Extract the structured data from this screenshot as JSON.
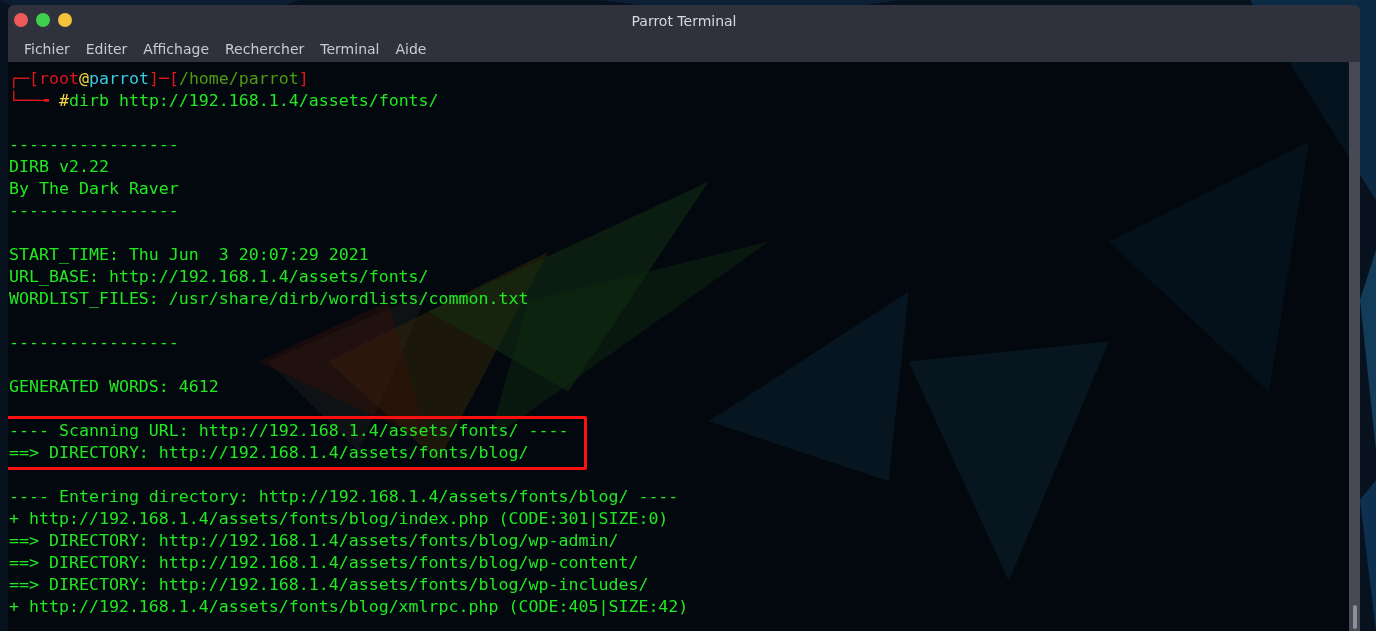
{
  "window": {
    "title": "Parrot Terminal",
    "buttons": [
      {
        "color": "#ed5a5a"
      },
      {
        "color": "#3fcf4f"
      },
      {
        "color": "#f6c13a"
      }
    ]
  },
  "menu": [
    "Fichier",
    "Editer",
    "Affichage",
    "Rechercher",
    "Terminal",
    "Aide"
  ],
  "prompt": {
    "line_1": [
      {
        "text": "┌─[",
        "color": "#e0161c"
      },
      {
        "text": "root",
        "color": "#e0161c"
      },
      {
        "text": "@",
        "color": "#f4d73c"
      },
      {
        "text": "parrot",
        "color": "#3cc9e0"
      },
      {
        "text": "]─[",
        "color": "#e0161c"
      },
      {
        "text": "/home/parrot",
        "color": "#4f9a12"
      },
      {
        "text": "]",
        "color": "#e0161c"
      }
    ],
    "line_2": [
      {
        "text": "└──╼ ",
        "color": "#e0161c"
      },
      {
        "text": "#",
        "color": "#f4d73c"
      },
      {
        "text": "dirb http://192.168.1.4/assets/fonts/",
        "color": "#22e822"
      }
    ]
  },
  "output": [
    {
      "kind": "blank"
    },
    {
      "kind": "line",
      "text": "-----------------"
    },
    {
      "kind": "line",
      "text": "DIRB v2.22"
    },
    {
      "kind": "line",
      "text": "By The Dark Raver"
    },
    {
      "kind": "line",
      "text": "-----------------"
    },
    {
      "kind": "blank"
    },
    {
      "kind": "line",
      "text": "START_TIME: Thu Jun  3 20:07:29 2021"
    },
    {
      "kind": "line",
      "text": "URL_BASE: http://192.168.1.4/assets/fonts/"
    },
    {
      "kind": "line",
      "text": "WORDLIST_FILES: /usr/share/dirb/wordlists/common.txt"
    },
    {
      "kind": "blank"
    },
    {
      "kind": "line",
      "text": "-----------------"
    },
    {
      "kind": "blank"
    },
    {
      "kind": "line",
      "text": "GENERATED WORDS: 4612"
    },
    {
      "kind": "blank"
    },
    {
      "kind": "boxed",
      "lines": [
        "---- Scanning URL: http://192.168.1.4/assets/fonts/ ----",
        "==> DIRECTORY: http://192.168.1.4/assets/fonts/blog/"
      ]
    },
    {
      "kind": "blank"
    },
    {
      "kind": "line",
      "text": "---- Entering directory: http://192.168.1.4/assets/fonts/blog/ ----"
    },
    {
      "kind": "line",
      "text": "+ http://192.168.1.4/assets/fonts/blog/index.php (CODE:301|SIZE:0)"
    },
    {
      "kind": "line",
      "text": "==> DIRECTORY: http://192.168.1.4/assets/fonts/blog/wp-admin/"
    },
    {
      "kind": "line",
      "text": "==> DIRECTORY: http://192.168.1.4/assets/fonts/blog/wp-content/"
    },
    {
      "kind": "line",
      "text": "==> DIRECTORY: http://192.168.1.4/assets/fonts/blog/wp-includes/"
    },
    {
      "kind": "line",
      "text": "+ http://192.168.1.4/assets/fonts/blog/xmlrpc.php (CODE:405|SIZE:42)"
    }
  ]
}
